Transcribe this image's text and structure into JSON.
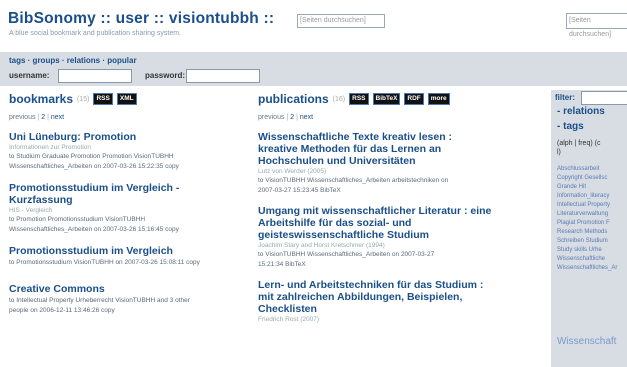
{
  "header": {
    "logo": "BibSonomy :: user :: visiontubbh ::",
    "search_placeholder": "[Seiten durchsuchen]",
    "tagline": "A blue social bookmark and publication sharing system.",
    "right_search_placeholder": "[Seiten durchsuchen]"
  },
  "nav": {
    "links": "tags · groups · relations · popular",
    "username_label": "username:",
    "password_label": "password:"
  },
  "bookmarks": {
    "title": "bookmarks",
    "count": "(15)",
    "formats": [
      "RSS",
      "XML"
    ],
    "pager": {
      "previous": "previous",
      "page": "2",
      "next": "next"
    },
    "entries": [
      {
        "title": "Uni Lüneburg: Promotion",
        "sub": "Informationen zur Promotion",
        "meta1": "to Studium Graduate Promotion Promotion VisionTUBHH",
        "meta2": "Wissenschaftliches_Arbeiten on 2007-03-26 15:22:35 copy"
      },
      {
        "title": "Promotionsstudium im Vergleich - Kurzfassung",
        "sub": "HIS - Vergleich",
        "meta1": "to Promotion Promotionsstudium VisionTUBHH",
        "meta2": "Wissenschaftliches_Arbeiten on 2007-03-26 15:16:45 copy"
      },
      {
        "title": "Promotionsstudium im Vergleich",
        "sub": "",
        "meta1": "to Promotionsstudium VisionTUBHH on 2007-03-26 15:08:11 copy",
        "meta2": ""
      },
      {
        "title": "Creative Commons",
        "sub": "",
        "meta1": "to Intellectual Property Urheberrecht VisionTUBHH and 3 other",
        "meta2": "people on 2006-12-11 13:46:26 copy"
      }
    ]
  },
  "publications": {
    "title": "publications",
    "count": "(16)",
    "formats": [
      "RSS",
      "BibTeX",
      "RDF",
      "more"
    ],
    "pager": {
      "previous": "previous",
      "page": "2",
      "next": "next"
    },
    "entries": [
      {
        "title": "Wissenschaftliche Texte kreativ lesen : kreative Methoden für das Lernen an Hochschulen und Universitäten",
        "authors": "Lutz von Werder (2005)",
        "meta1": "to VisionTUBHH Wissenschaftliches_Arbeiten arbeitstechniken on",
        "meta2": "2007-03-27 15:23:45 BibTeX"
      },
      {
        "title": "Umgang mit wissenschaftlicher Literatur : eine Arbeitshilfe für das sozial- und geisteswissenschaftliche Studium",
        "authors": "Joachim Stary and Horst Kretschmer (1994)",
        "meta1": "to VisionTUBHH Wissenschaftliches_Arbeiten on 2007-03-27",
        "meta2": "15:21:34 BibTeX"
      },
      {
        "title": "Lern- und Arbeitstechniken für das Studium : mit zahlreichen Abbildungen, Beispielen, Checklisten",
        "authors": "Friedrich Rost (2007)",
        "meta1": "",
        "meta2": ""
      }
    ]
  },
  "sidebar": {
    "filter_label": "filter:",
    "relations": "- relations",
    "tags": "- tags",
    "sort_options": "(alph | freq) (c",
    "sort_cont": "l)",
    "tagcloud": [
      "Abschlussarbeit",
      "Copyright  Gesellsc",
      "Grande        Hit",
      "Information_literacy",
      "Intellectual Property",
      "Literaturverwaltung",
      "Plagiat  Promotion  F",
      "Research Methods",
      "Schreiben   Studium",
      "Study skills   Urhe",
      "Wissenschaftliche",
      "Wissenschaftliches_Ar"
    ],
    "big_tag": "Wissenschaft"
  }
}
